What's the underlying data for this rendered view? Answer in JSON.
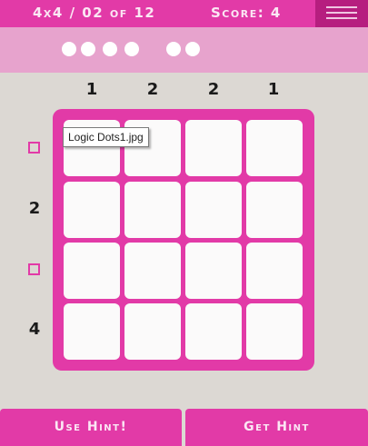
{
  "header": {
    "level_text": "4x4 / 02 of 12",
    "score_text": "Score: 4",
    "menu_icon": "hamburger-menu-icon"
  },
  "progress_dots": {
    "group_a": 4,
    "group_b": 2
  },
  "column_clues": [
    "1",
    "2",
    "2",
    "1"
  ],
  "row_clues": [
    "",
    "2",
    "",
    "4"
  ],
  "tooltip": "Logic Dots1.jpg",
  "footer": {
    "use_hint": "Use Hint!",
    "get_hint": "Get Hint"
  },
  "colors": {
    "accent": "#e23aa7",
    "accent_dark": "#b61e7f",
    "accent_light": "#e7a3cd",
    "background": "#dcd8d3"
  }
}
